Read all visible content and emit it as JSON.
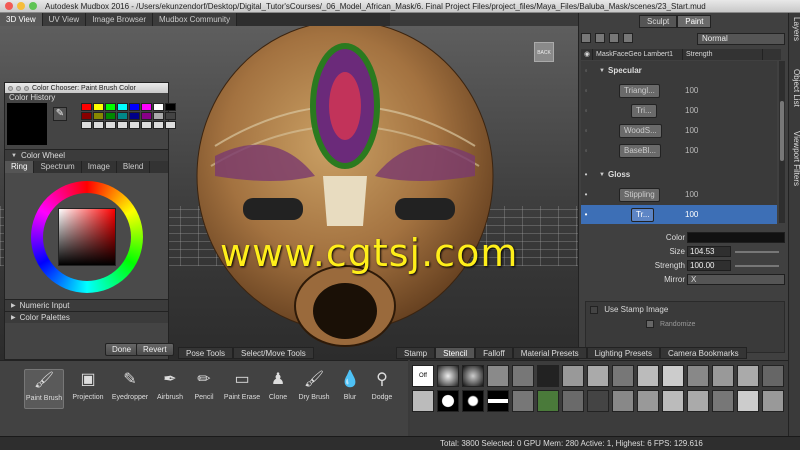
{
  "window": {
    "app_title": "Autodesk Mudbox 2016 - /Users/ekunzendorf/Desktop/Digital_Tutor'sCourses/_06_Model_African_Mask/6. Final Project Files/project_files/Maya_Files/Baluba_Mask/scenes/23_Start.mud"
  },
  "viewport_tabs": [
    "3D View",
    "UV View",
    "Image Browser",
    "Mudbox Community"
  ],
  "watermark": "www.cgtsj.com",
  "color_chooser": {
    "title": "Color Chooser: Paint Brush Color",
    "history_label": "Color History",
    "wheel_section": "Color Wheel",
    "tabs": [
      "Ring",
      "Spectrum",
      "Image",
      "Blend"
    ],
    "numeric_input": "Numeric Input",
    "color_palettes": "Color Palettes",
    "done": "Done",
    "revert": "Revert"
  },
  "right_panel": {
    "tabs": [
      "Sculpt",
      "Paint"
    ],
    "blend_mode": "Normal",
    "col_headers": [
      "MaskFaceGeo Lambert1",
      "Strength"
    ],
    "layers": [
      {
        "name": "Specular",
        "type": "group"
      },
      {
        "name": "Triangl...",
        "value": "100"
      },
      {
        "name": "Tri...",
        "value": "100"
      },
      {
        "name": "WoodS...",
        "value": "100"
      },
      {
        "name": "BaseBl...",
        "value": "100"
      },
      {
        "name": "Gloss",
        "type": "group"
      },
      {
        "name": "Stippling",
        "value": "100"
      },
      {
        "name": "Tr...",
        "value": "100"
      }
    ],
    "props": {
      "color_label": "Color",
      "size_label": "Size",
      "size_value": "104.53",
      "strength_label": "Strength",
      "strength_value": "100.00",
      "mirror_label": "Mirror",
      "mirror_value": "X"
    },
    "stamp": {
      "use_stamp": "Use Stamp Image",
      "randomize": "Randomize"
    }
  },
  "side_tabs": [
    "Layers",
    "Object List",
    "Viewport Filters"
  ],
  "tray_tabs_left": [
    "Pose Tools",
    "Select/Move Tools"
  ],
  "tray_tabs_right": [
    "Stamp",
    "Stencil",
    "Falloff",
    "Material Presets",
    "Lighting Presets",
    "Camera Bookmarks"
  ],
  "tools": [
    "Paint Brush",
    "Projection",
    "Eyedropper",
    "Airbrush",
    "Pencil",
    "Paint Erase",
    "Clone",
    "Dry Brush",
    "Blur",
    "Dodge"
  ],
  "stencil_off": "Off",
  "status": "Total: 3800  Selected: 0 GPU Mem: 280  Active: 1, Highest: 6  FPS: 129.616"
}
